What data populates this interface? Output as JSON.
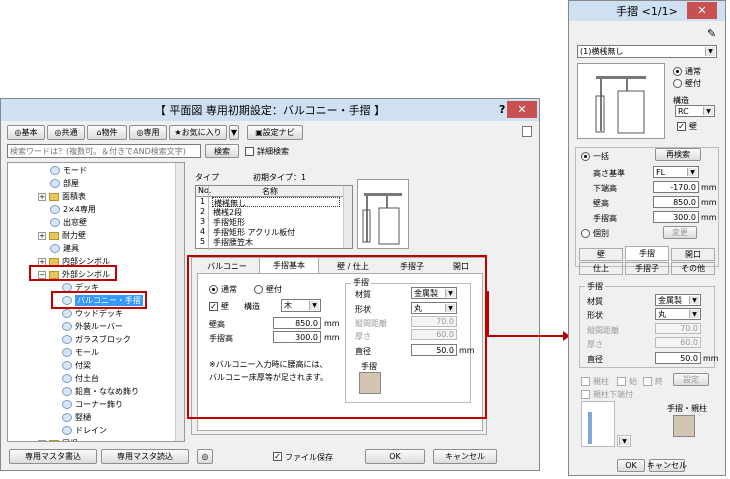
{
  "main": {
    "title": "【 平面図 専用初期設定：バルコニー・手摺 】",
    "help": "?",
    "close": "✕",
    "toolbar": {
      "basic": "基本",
      "common": "共通",
      "property": "物件",
      "dedicated": "専用",
      "favorites": "お気に入り",
      "settings_navi": "設定ナビ"
    },
    "search": {
      "placeholder": "検索ワードは？(複数可。＆付きでAND検索文字)",
      "button": "検索",
      "detail": "詳細検索"
    },
    "tree": [
      {
        "label": "モード"
      },
      {
        "label": "部屋"
      },
      {
        "label": "面積表"
      },
      {
        "label": "2×4専用"
      },
      {
        "label": "出窓壁"
      },
      {
        "label": "耐力壁"
      },
      {
        "label": "建具"
      },
      {
        "label": "内部シンボル"
      },
      {
        "label": "外部シンボル"
      },
      {
        "label": "デッキ"
      },
      {
        "label": "バルコニー・手摺"
      },
      {
        "label": "ウッドデッキ"
      },
      {
        "label": "外装ルーバー"
      },
      {
        "label": "ガラスブロック"
      },
      {
        "label": "モール"
      },
      {
        "label": "付梁"
      },
      {
        "label": "付土台"
      },
      {
        "label": "鉛直・ななめ飾り"
      },
      {
        "label": "コーナー飾り"
      },
      {
        "label": "竪樋"
      },
      {
        "label": "ドレイン"
      },
      {
        "label": "屋根"
      }
    ],
    "type_label": "タイプ",
    "initial_type": "初期タイプ：1",
    "table": {
      "headers": [
        "No.",
        "名称"
      ],
      "rows": [
        {
          "no": "1",
          "name": "横桟無し"
        },
        {
          "no": "2",
          "name": "横桟2段"
        },
        {
          "no": "3",
          "name": "手摺矩形"
        },
        {
          "no": "4",
          "name": "手摺矩形 アクリル板付"
        },
        {
          "no": "5",
          "name": "手摺腰笠木"
        }
      ]
    },
    "tabs": [
      "バルコニー",
      "手摺基本",
      "壁 / 仕上",
      "手摺子",
      "開口"
    ],
    "form": {
      "normal": "通常",
      "wall_attach": "壁付",
      "wall": "壁",
      "structure": "構造",
      "structure_value": "木",
      "wall_height": "壁高",
      "wall_height_value": "850.0",
      "rail_height": "手摺高",
      "rail_height_value": "300.0",
      "unit": "mm",
      "note": "※バルコニー入力時に腰高には、\nバルコニー床厚等が足されます。",
      "rail_group": "手摺",
      "material": "材質",
      "material_value": "金属製",
      "shape": "形状",
      "shape_value": "丸",
      "pitch": "縦間距離",
      "pitch_value": "70.0",
      "thickness": "厚さ",
      "thickness_value": "60.0",
      "diameter": "直径",
      "diameter_value": "50.0",
      "rail_color": "手摺"
    },
    "footer": {
      "write_master": "専用マスタ書込",
      "read_master": "専用マスタ読込",
      "file_save": "ファイル保存",
      "ok": "OK",
      "cancel": "キャンセル"
    }
  },
  "side": {
    "title": "手摺 <1/1>",
    "close": "✕",
    "dropdown": "(1)横桟無し",
    "normal": "通常",
    "wall_attach": "壁付",
    "structure": "構造",
    "structure_value": "RC",
    "wall": "壁",
    "bulk": "一括",
    "research": "再検索",
    "base_height": "高さ基準",
    "base_value": "FL",
    "lower_end": "下端高",
    "lower_value": "-170.0",
    "wall_height": "壁高",
    "wall_value": "850.0",
    "rail_height": "手摺高",
    "rail_value": "300.0",
    "unit": "mm",
    "individual": "個別",
    "change": "変更",
    "tabs_row1": [
      "壁",
      "手摺",
      "開口"
    ],
    "tabs_row2": [
      "仕上",
      "手摺子",
      "その他"
    ],
    "rail_group": "手摺",
    "material": "材質",
    "material_value": "金属製",
    "shape": "形状",
    "shape_value": "丸",
    "pitch": "縦間距離",
    "pitch_value": "70.0",
    "thickness": "厚さ",
    "thickness_value": "60.0",
    "diameter": "直径",
    "diameter_value": "50.0",
    "post": "親柱",
    "start": "始",
    "end": "終",
    "settings": "設定",
    "post_lower": "親柱下端付",
    "rail_post": "手摺・親柱",
    "ok": "OK",
    "cancel": "キャンセル"
  },
  "colors": {
    "red_highlight": "#c00000",
    "selection": "#3399ff",
    "swatch": "#d2c6b2"
  }
}
